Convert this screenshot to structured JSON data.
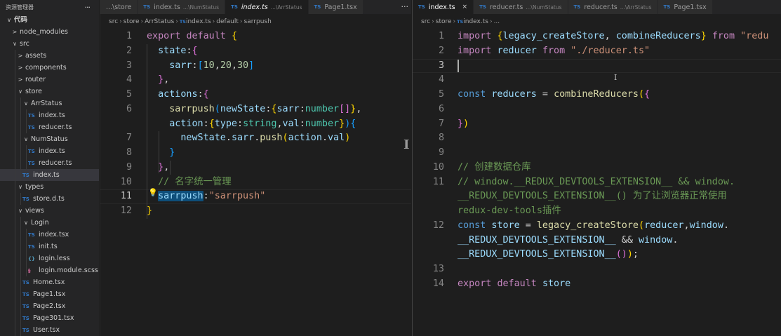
{
  "explorer": {
    "title": "资源管理器",
    "more": "···",
    "tree": [
      {
        "label": "代码",
        "kind": "root",
        "open": true,
        "depth": 0
      },
      {
        "label": "node_modules",
        "kind": "folder",
        "open": false,
        "depth": 1
      },
      {
        "label": "src",
        "kind": "folder",
        "open": true,
        "depth": 1
      },
      {
        "label": "assets",
        "kind": "folder",
        "open": false,
        "depth": 2
      },
      {
        "label": "components",
        "kind": "folder",
        "open": false,
        "depth": 2
      },
      {
        "label": "router",
        "kind": "folder",
        "open": false,
        "depth": 2
      },
      {
        "label": "store",
        "kind": "folder",
        "open": true,
        "depth": 2
      },
      {
        "label": "ArrStatus",
        "kind": "folder",
        "open": true,
        "depth": 3
      },
      {
        "label": "index.ts",
        "kind": "ts",
        "depth": 4
      },
      {
        "label": "reducer.ts",
        "kind": "ts",
        "depth": 4
      },
      {
        "label": "NumStatus",
        "kind": "folder",
        "open": true,
        "depth": 3
      },
      {
        "label": "index.ts",
        "kind": "ts",
        "depth": 4
      },
      {
        "label": "reducer.ts",
        "kind": "ts",
        "depth": 4
      },
      {
        "label": "index.ts",
        "kind": "ts",
        "depth": 3,
        "active": true
      },
      {
        "label": "types",
        "kind": "folder",
        "open": true,
        "depth": 2
      },
      {
        "label": "store.d.ts",
        "kind": "ts",
        "depth": 3
      },
      {
        "label": "views",
        "kind": "folder",
        "open": true,
        "depth": 2
      },
      {
        "label": "Login",
        "kind": "folder",
        "open": true,
        "depth": 3
      },
      {
        "label": "index.tsx",
        "kind": "ts",
        "depth": 4
      },
      {
        "label": "init.ts",
        "kind": "ts",
        "depth": 4
      },
      {
        "label": "login.less",
        "kind": "less",
        "depth": 4
      },
      {
        "label": "login.module.scss",
        "kind": "scss",
        "depth": 4
      },
      {
        "label": "Home.tsx",
        "kind": "ts",
        "depth": 3
      },
      {
        "label": "Page1.tsx",
        "kind": "ts",
        "depth": 3
      },
      {
        "label": "Page2.tsx",
        "kind": "ts",
        "depth": 3
      },
      {
        "label": "Page301.tsx",
        "kind": "ts",
        "depth": 3
      },
      {
        "label": "User.tsx",
        "kind": "ts",
        "depth": 3
      }
    ]
  },
  "icons": {
    "ts": "TS",
    "less": "{}",
    "scss": "§",
    "open": "∨",
    "closed": ">"
  },
  "left_editor": {
    "tabs": [
      {
        "label": "...\\store",
        "hint": "",
        "icon": false,
        "active": false,
        "italic": false
      },
      {
        "label": "index.ts",
        "hint": "...\\NumStatus",
        "icon": true,
        "active": false,
        "italic": false
      },
      {
        "label": "index.ts",
        "hint": "...\\ArrStatus",
        "icon": true,
        "active": true,
        "italic": true
      },
      {
        "label": "Page1.tsx",
        "hint": "",
        "icon": true,
        "active": false,
        "italic": false
      }
    ],
    "more": "···",
    "breadcrumb": [
      "src",
      "store",
      "ArrStatus",
      "index.ts",
      "default",
      "sarrpush"
    ],
    "line_numbers": [
      "1",
      "2",
      "3",
      "4",
      "5",
      "6",
      "",
      "7",
      "8",
      "9",
      "10",
      "11",
      "12"
    ],
    "current_line_index": 11,
    "code": [
      [
        [
          "kw",
          "export"
        ],
        [
          "pu",
          " "
        ],
        [
          "kw",
          "default"
        ],
        [
          "pu",
          " "
        ],
        [
          "br1",
          "{"
        ]
      ],
      [
        [
          "pu",
          "  "
        ],
        [
          "pr",
          "state"
        ],
        [
          "pu",
          ":"
        ],
        [
          "br2",
          "{"
        ]
      ],
      [
        [
          "pu",
          "    "
        ],
        [
          "pr",
          "sarr"
        ],
        [
          "pu",
          ":"
        ],
        [
          "br3",
          "["
        ],
        [
          "nu",
          "10"
        ],
        [
          "pu",
          ","
        ],
        [
          "nu",
          "20"
        ],
        [
          "pu",
          ","
        ],
        [
          "nu",
          "30"
        ],
        [
          "br3",
          "]"
        ]
      ],
      [
        [
          "pu",
          "  "
        ],
        [
          "br2",
          "}"
        ],
        [
          "pu",
          ","
        ]
      ],
      [
        [
          "pu",
          "  "
        ],
        [
          "pr",
          "actions"
        ],
        [
          "pu",
          ":"
        ],
        [
          "br2",
          "{"
        ]
      ],
      [
        [
          "pu",
          "    "
        ],
        [
          "fn",
          "sarrpush"
        ],
        [
          "br3",
          "("
        ],
        [
          "pr",
          "newState"
        ],
        [
          "pu",
          ":"
        ],
        [
          "br1",
          "{"
        ],
        [
          "pr",
          "sarr"
        ],
        [
          "pu",
          ":"
        ],
        [
          "ty",
          "number"
        ],
        [
          "br2",
          "[]"
        ],
        [
          "br1",
          "}"
        ],
        [
          "pu",
          ","
        ]
      ],
      [
        [
          "pu",
          "    "
        ],
        [
          "pr",
          "action"
        ],
        [
          "pu",
          ":"
        ],
        [
          "br1",
          "{"
        ],
        [
          "pr",
          "type"
        ],
        [
          "pu",
          ":"
        ],
        [
          "ty",
          "string"
        ],
        [
          "pu",
          ","
        ],
        [
          "pr",
          "val"
        ],
        [
          "pu",
          ":"
        ],
        [
          "ty",
          "number"
        ],
        [
          "br1",
          "}"
        ],
        [
          "br3",
          ")"
        ],
        [
          "br3",
          "{"
        ]
      ],
      [
        [
          "pu",
          "      "
        ],
        [
          "pr",
          "newState"
        ],
        [
          "pu",
          "."
        ],
        [
          "pr",
          "sarr"
        ],
        [
          "pu",
          "."
        ],
        [
          "fn",
          "push"
        ],
        [
          "br1",
          "("
        ],
        [
          "pr",
          "action"
        ],
        [
          "pu",
          "."
        ],
        [
          "pr",
          "val"
        ],
        [
          "br1",
          ")"
        ]
      ],
      [
        [
          "pu",
          "    "
        ],
        [
          "br3",
          "}"
        ]
      ],
      [
        [
          "pu",
          "  "
        ],
        [
          "br2",
          "}"
        ],
        [
          "pu",
          ","
        ]
      ],
      [
        [
          "pu",
          "  "
        ],
        [
          "cm",
          "// 名字统一管理"
        ]
      ],
      [
        [
          "pu",
          "  "
        ],
        [
          "prhl",
          "sarrpush"
        ],
        [
          "pu",
          ":"
        ],
        [
          "st",
          "\"sarrpush\""
        ]
      ],
      [
        [
          "br1",
          "}"
        ]
      ]
    ]
  },
  "right_editor": {
    "tabs": [
      {
        "label": "index.ts",
        "hint": "",
        "icon": true,
        "active": true,
        "italic": false,
        "close": "×"
      },
      {
        "label": "reducer.ts",
        "hint": "...\\NumStatus",
        "icon": true,
        "active": false,
        "italic": false
      },
      {
        "label": "reducer.ts",
        "hint": "...\\ArrStatus",
        "icon": true,
        "active": false,
        "italic": false
      },
      {
        "label": "Page1.tsx",
        "hint": "",
        "icon": true,
        "active": false,
        "italic": false
      }
    ],
    "breadcrumb": [
      "src",
      "store",
      "index.ts",
      "..."
    ],
    "line_numbers": [
      "1",
      "2",
      "3",
      "4",
      "5",
      "6",
      "7",
      "8",
      "9",
      "10",
      "11",
      "",
      "",
      "12",
      "",
      "",
      "13",
      "14"
    ],
    "current_line_index": 2,
    "code": [
      [
        [
          "kw",
          "import"
        ],
        [
          "pu",
          " "
        ],
        [
          "br1",
          "{"
        ],
        [
          "pr",
          "legacy_createStore"
        ],
        [
          "pu",
          ", "
        ],
        [
          "pr",
          "combineReducers"
        ],
        [
          "br1",
          "}"
        ],
        [
          "pu",
          " "
        ],
        [
          "kw",
          "from"
        ],
        [
          "pu",
          " "
        ],
        [
          "st",
          "\"redu"
        ]
      ],
      [
        [
          "kw",
          "import"
        ],
        [
          "pu",
          " "
        ],
        [
          "pr",
          "reducer"
        ],
        [
          "pu",
          " "
        ],
        [
          "kw",
          "from"
        ],
        [
          "pu",
          " "
        ],
        [
          "st",
          "\"./reducer.ts\""
        ]
      ],
      [],
      [],
      [
        [
          "kb",
          "const"
        ],
        [
          "pu",
          " "
        ],
        [
          "pr",
          "reducers"
        ],
        [
          "pu",
          " = "
        ],
        [
          "fn",
          "combineReducers"
        ],
        [
          "br1",
          "("
        ],
        [
          "br2",
          "{"
        ]
      ],
      [],
      [
        [
          "br2",
          "}"
        ],
        [
          "br1",
          ")"
        ]
      ],
      [],
      [],
      [
        [
          "cm",
          "// 创建数据仓库"
        ]
      ],
      [
        [
          "cm",
          "// window.__REDUX_DEVTOOLS_EXTENSION__ && window."
        ]
      ],
      [
        [
          "cm",
          "__REDUX_DEVTOOLS_EXTENSION__() 为了让浏览器正常使用"
        ]
      ],
      [
        [
          "cm",
          "redux-dev-tools插件"
        ]
      ],
      [
        [
          "kb",
          "const"
        ],
        [
          "pu",
          " "
        ],
        [
          "pr",
          "store"
        ],
        [
          "pu",
          " = "
        ],
        [
          "fn",
          "legacy_createStore"
        ],
        [
          "br1",
          "("
        ],
        [
          "pr",
          "reducer"
        ],
        [
          "pu",
          ","
        ],
        [
          "pr",
          "window"
        ],
        [
          "pu",
          "."
        ]
      ],
      [
        [
          "pr",
          "__REDUX_DEVTOOLS_EXTENSION__"
        ],
        [
          "pu",
          " && "
        ],
        [
          "pr",
          "window"
        ],
        [
          "pu",
          "."
        ]
      ],
      [
        [
          "pr",
          "__REDUX_DEVTOOLS_EXTENSION__"
        ],
        [
          "br2",
          "()"
        ],
        [
          "br1",
          ")"
        ],
        [
          "pu",
          ";"
        ]
      ],
      [],
      [
        [
          "kw",
          "export"
        ],
        [
          "pu",
          " "
        ],
        [
          "kw",
          "default"
        ],
        [
          "pu",
          " "
        ],
        [
          "pr",
          "store"
        ]
      ]
    ]
  }
}
